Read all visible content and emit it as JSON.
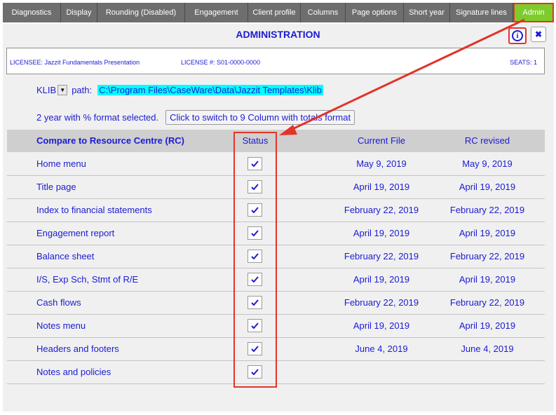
{
  "tabs": [
    {
      "label": "Diagnostics"
    },
    {
      "label": "Display"
    },
    {
      "label": "Rounding (Disabled)"
    },
    {
      "label": "Engagement"
    },
    {
      "label": "Client profile"
    },
    {
      "label": "Columns"
    },
    {
      "label": "Page options"
    },
    {
      "label": "Short year"
    },
    {
      "label": "Signature lines"
    },
    {
      "label": "Admin"
    }
  ],
  "header": {
    "title": "ADMINISTRATION",
    "info_icon": "i",
    "close_icon": "✖"
  },
  "license": {
    "licensee": "LICENSEE:  Jazzit Fundamentals Presentation",
    "license_no": "LICENSE #:  S01-0000-0000",
    "seats": "SEATS: 1"
  },
  "klib": {
    "label": "KLIB",
    "path_label": "path:",
    "path_value": "C:\\Program Files\\CaseWare\\Data\\Jazzit Templates\\Klib"
  },
  "format": {
    "text": "2 year with % format selected.",
    "button": "Click to switch to 9 Column with totals format"
  },
  "table": {
    "headers": {
      "name": "Compare to Resource Centre (RC)",
      "status": "Status",
      "current": "Current File",
      "rc": "RC revised"
    },
    "rows": [
      {
        "name": "Home menu",
        "current": "May 9, 2019",
        "rc": "May 9, 2019"
      },
      {
        "name": "Title page",
        "current": "April 19, 2019",
        "rc": "April 19, 2019"
      },
      {
        "name": "Index to financial statements",
        "current": "February 22, 2019",
        "rc": "February 22, 2019"
      },
      {
        "name": "Engagement report",
        "current": "April 19, 2019",
        "rc": "April 19, 2019"
      },
      {
        "name": "Balance sheet",
        "current": "February 22, 2019",
        "rc": "February 22, 2019"
      },
      {
        "name": "I/S, Exp Sch, Stmt of R/E",
        "current": "April 19, 2019",
        "rc": "April 19, 2019"
      },
      {
        "name": "Cash flows",
        "current": "February 22, 2019",
        "rc": "February 22, 2019"
      },
      {
        "name": "Notes menu",
        "current": "April 19, 2019",
        "rc": "April 19, 2019"
      },
      {
        "name": "Headers and footers",
        "current": "June 4, 2019",
        "rc": "June 4, 2019"
      },
      {
        "name": "Notes and policies",
        "current": "",
        "rc": ""
      }
    ]
  },
  "colors": {
    "accent_text": "#1b1bd4",
    "active_tab": "#7dcc2b",
    "highlight": "#e3332a",
    "path_highlight": "#00ffff"
  }
}
